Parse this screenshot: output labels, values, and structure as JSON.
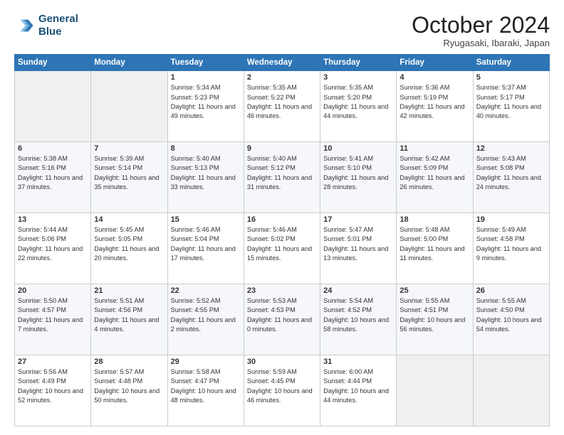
{
  "header": {
    "logo_line1": "General",
    "logo_line2": "Blue",
    "month": "October 2024",
    "location": "Ryugasaki, Ibaraki, Japan"
  },
  "weekdays": [
    "Sunday",
    "Monday",
    "Tuesday",
    "Wednesday",
    "Thursday",
    "Friday",
    "Saturday"
  ],
  "weeks": [
    [
      {
        "day": "",
        "content": ""
      },
      {
        "day": "",
        "content": ""
      },
      {
        "day": "1",
        "content": "Sunrise: 5:34 AM\nSunset: 5:23 PM\nDaylight: 11 hours and 49 minutes."
      },
      {
        "day": "2",
        "content": "Sunrise: 5:35 AM\nSunset: 5:22 PM\nDaylight: 11 hours and 46 minutes."
      },
      {
        "day": "3",
        "content": "Sunrise: 5:35 AM\nSunset: 5:20 PM\nDaylight: 11 hours and 44 minutes."
      },
      {
        "day": "4",
        "content": "Sunrise: 5:36 AM\nSunset: 5:19 PM\nDaylight: 11 hours and 42 minutes."
      },
      {
        "day": "5",
        "content": "Sunrise: 5:37 AM\nSunset: 5:17 PM\nDaylight: 11 hours and 40 minutes."
      }
    ],
    [
      {
        "day": "6",
        "content": "Sunrise: 5:38 AM\nSunset: 5:16 PM\nDaylight: 11 hours and 37 minutes."
      },
      {
        "day": "7",
        "content": "Sunrise: 5:39 AM\nSunset: 5:14 PM\nDaylight: 11 hours and 35 minutes."
      },
      {
        "day": "8",
        "content": "Sunrise: 5:40 AM\nSunset: 5:13 PM\nDaylight: 11 hours and 33 minutes."
      },
      {
        "day": "9",
        "content": "Sunrise: 5:40 AM\nSunset: 5:12 PM\nDaylight: 11 hours and 31 minutes."
      },
      {
        "day": "10",
        "content": "Sunrise: 5:41 AM\nSunset: 5:10 PM\nDaylight: 11 hours and 28 minutes."
      },
      {
        "day": "11",
        "content": "Sunrise: 5:42 AM\nSunset: 5:09 PM\nDaylight: 11 hours and 26 minutes."
      },
      {
        "day": "12",
        "content": "Sunrise: 5:43 AM\nSunset: 5:08 PM\nDaylight: 11 hours and 24 minutes."
      }
    ],
    [
      {
        "day": "13",
        "content": "Sunrise: 5:44 AM\nSunset: 5:06 PM\nDaylight: 11 hours and 22 minutes."
      },
      {
        "day": "14",
        "content": "Sunrise: 5:45 AM\nSunset: 5:05 PM\nDaylight: 11 hours and 20 minutes."
      },
      {
        "day": "15",
        "content": "Sunrise: 5:46 AM\nSunset: 5:04 PM\nDaylight: 11 hours and 17 minutes."
      },
      {
        "day": "16",
        "content": "Sunrise: 5:46 AM\nSunset: 5:02 PM\nDaylight: 11 hours and 15 minutes."
      },
      {
        "day": "17",
        "content": "Sunrise: 5:47 AM\nSunset: 5:01 PM\nDaylight: 11 hours and 13 minutes."
      },
      {
        "day": "18",
        "content": "Sunrise: 5:48 AM\nSunset: 5:00 PM\nDaylight: 11 hours and 11 minutes."
      },
      {
        "day": "19",
        "content": "Sunrise: 5:49 AM\nSunset: 4:58 PM\nDaylight: 11 hours and 9 minutes."
      }
    ],
    [
      {
        "day": "20",
        "content": "Sunrise: 5:50 AM\nSunset: 4:57 PM\nDaylight: 11 hours and 7 minutes."
      },
      {
        "day": "21",
        "content": "Sunrise: 5:51 AM\nSunset: 4:56 PM\nDaylight: 11 hours and 4 minutes."
      },
      {
        "day": "22",
        "content": "Sunrise: 5:52 AM\nSunset: 4:55 PM\nDaylight: 11 hours and 2 minutes."
      },
      {
        "day": "23",
        "content": "Sunrise: 5:53 AM\nSunset: 4:53 PM\nDaylight: 11 hours and 0 minutes."
      },
      {
        "day": "24",
        "content": "Sunrise: 5:54 AM\nSunset: 4:52 PM\nDaylight: 10 hours and 58 minutes."
      },
      {
        "day": "25",
        "content": "Sunrise: 5:55 AM\nSunset: 4:51 PM\nDaylight: 10 hours and 56 minutes."
      },
      {
        "day": "26",
        "content": "Sunrise: 5:55 AM\nSunset: 4:50 PM\nDaylight: 10 hours and 54 minutes."
      }
    ],
    [
      {
        "day": "27",
        "content": "Sunrise: 5:56 AM\nSunset: 4:49 PM\nDaylight: 10 hours and 52 minutes."
      },
      {
        "day": "28",
        "content": "Sunrise: 5:57 AM\nSunset: 4:48 PM\nDaylight: 10 hours and 50 minutes."
      },
      {
        "day": "29",
        "content": "Sunrise: 5:58 AM\nSunset: 4:47 PM\nDaylight: 10 hours and 48 minutes."
      },
      {
        "day": "30",
        "content": "Sunrise: 5:59 AM\nSunset: 4:45 PM\nDaylight: 10 hours and 46 minutes."
      },
      {
        "day": "31",
        "content": "Sunrise: 6:00 AM\nSunset: 4:44 PM\nDaylight: 10 hours and 44 minutes."
      },
      {
        "day": "",
        "content": ""
      },
      {
        "day": "",
        "content": ""
      }
    ]
  ]
}
